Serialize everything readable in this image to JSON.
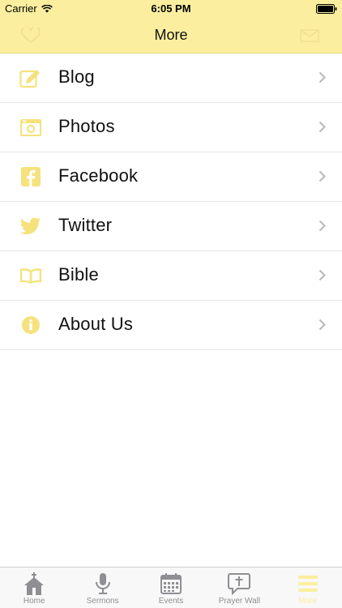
{
  "status_bar": {
    "carrier": "Carrier",
    "time": "6:05 PM"
  },
  "nav": {
    "title": "More",
    "left_icon": "heart-icon",
    "right_icon": "mail-icon"
  },
  "menu": {
    "items": [
      {
        "label": "Blog",
        "icon": "edit-icon"
      },
      {
        "label": "Photos",
        "icon": "camera-icon"
      },
      {
        "label": "Facebook",
        "icon": "facebook-icon"
      },
      {
        "label": "Twitter",
        "icon": "twitter-icon"
      },
      {
        "label": "Bible",
        "icon": "book-icon"
      },
      {
        "label": "About Us",
        "icon": "info-icon"
      }
    ]
  },
  "tabs": [
    {
      "label": "Home",
      "icon": "church-icon",
      "active": false
    },
    {
      "label": "Sermons",
      "icon": "microphone-icon",
      "active": false
    },
    {
      "label": "Events",
      "icon": "calendar-icon",
      "active": false
    },
    {
      "label": "Prayer Wall",
      "icon": "prayer-icon",
      "active": false
    },
    {
      "label": "More",
      "icon": "menu-icon",
      "active": true
    }
  ],
  "colors": {
    "accent": "#fbef9f",
    "icon_yellow": "#f5e27d",
    "tab_gray": "#8e8e93"
  }
}
